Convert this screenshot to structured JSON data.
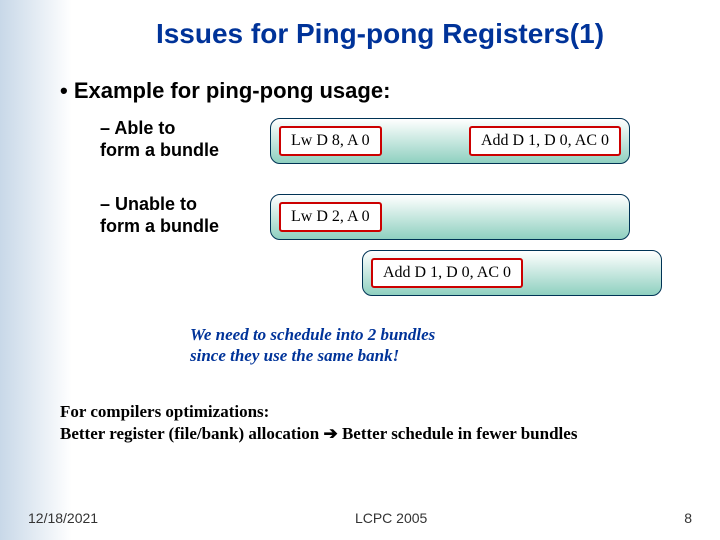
{
  "title": "Issues for Ping-pong Registers(1)",
  "bullet1": "Example for ping-pong usage:",
  "rows": [
    {
      "label_line1": "– Able to",
      "label_line2": "form a bundle",
      "bundles": [
        {
          "instr1": "Lw D 8, A 0",
          "instr2": "Add D 1, D 0, AC 0"
        }
      ]
    },
    {
      "label_line1": "– Unable to",
      "label_line2": "form a bundle",
      "bundles": [
        {
          "instr1": "Lw D 2, A 0"
        },
        {
          "instr1": "Add D 1, D 0, AC 0",
          "offset": true
        }
      ]
    }
  ],
  "note_line1": "We need to schedule into 2 bundles",
  "note_line2": "since they use the same bank!",
  "compilers_line1": "For compilers optimizations:",
  "compilers_line2a": "Better register (file/bank) allocation ",
  "compilers_arrow": "➔",
  "compilers_line2b": " Better schedule in fewer bundles",
  "footer": {
    "date": "12/18/2021",
    "venue": "LCPC 2005",
    "pagenum": "8"
  }
}
